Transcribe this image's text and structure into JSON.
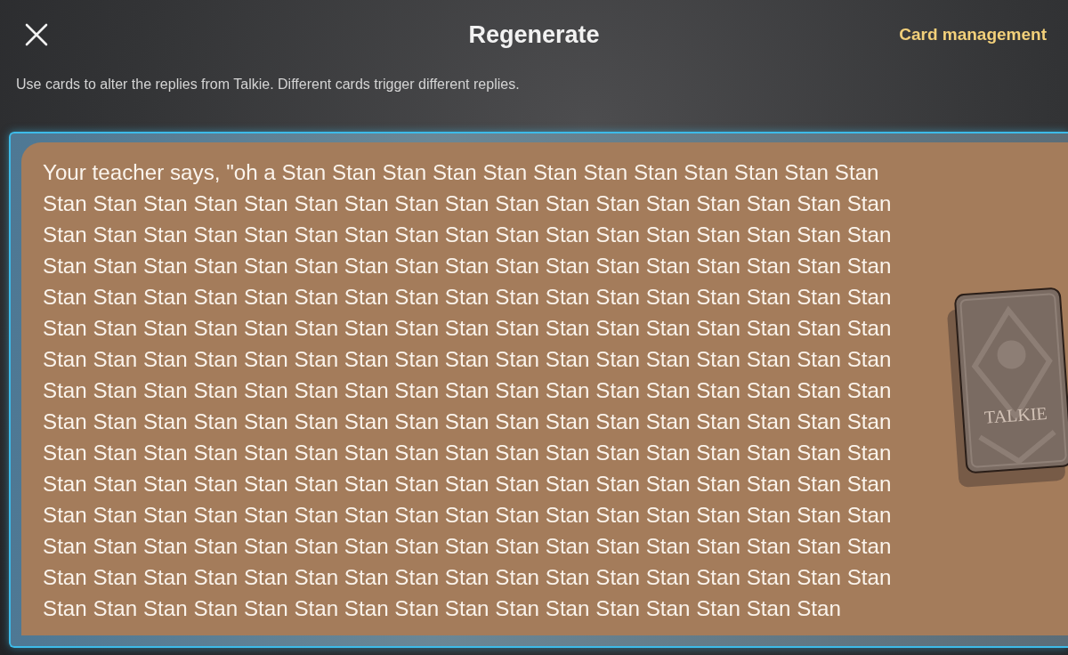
{
  "header": {
    "title": "Regenerate",
    "action": "Card management"
  },
  "hint": "Use cards to alter the replies from Talkie. Different cards trigger different replies.",
  "reply": {
    "text": "Your teacher says, \"oh a Stan Stan Stan Stan Stan Stan Stan Stan Stan Stan Stan Stan Stan Stan Stan Stan Stan Stan Stan Stan Stan Stan Stan Stan Stan Stan Stan Stan Stan Stan Stan Stan Stan Stan Stan Stan Stan Stan Stan Stan Stan Stan Stan Stan Stan Stan Stan Stan Stan Stan Stan Stan Stan Stan Stan Stan Stan Stan Stan Stan Stan Stan Stan Stan Stan Stan Stan Stan Stan Stan Stan Stan Stan Stan Stan Stan Stan Stan Stan Stan Stan Stan Stan Stan Stan Stan Stan Stan Stan Stan Stan Stan Stan Stan Stan Stan Stan Stan Stan Stan Stan Stan Stan Stan Stan Stan Stan Stan Stan Stan Stan Stan Stan Stan Stan Stan Stan Stan Stan Stan Stan Stan Stan Stan Stan Stan Stan Stan Stan Stan Stan Stan Stan Stan Stan Stan Stan Stan Stan Stan Stan Stan Stan Stan Stan Stan Stan Stan Stan Stan Stan Stan Stan Stan Stan Stan Stan Stan Stan Stan Stan Stan Stan Stan Stan Stan Stan Stan Stan Stan Stan Stan Stan Stan Stan Stan Stan Stan Stan Stan Stan Stan Stan Stan Stan Stan Stan Stan Stan Stan Stan Stan Stan Stan Stan Stan Stan Stan Stan Stan Stan Stan Stan Stan Stan Stan Stan Stan Stan Stan Stan Stan Stan Stan Stan Stan Stan Stan Stan Stan Stan Stan Stan Stan Stan Stan Stan Stan Stan Stan Stan Stan Stan Stan Stan Stan Stan Stan Stan Stan Stan Stan Stan Stan Stan Stan Stan Stan Stan",
    "card_label": "TALKIE"
  }
}
